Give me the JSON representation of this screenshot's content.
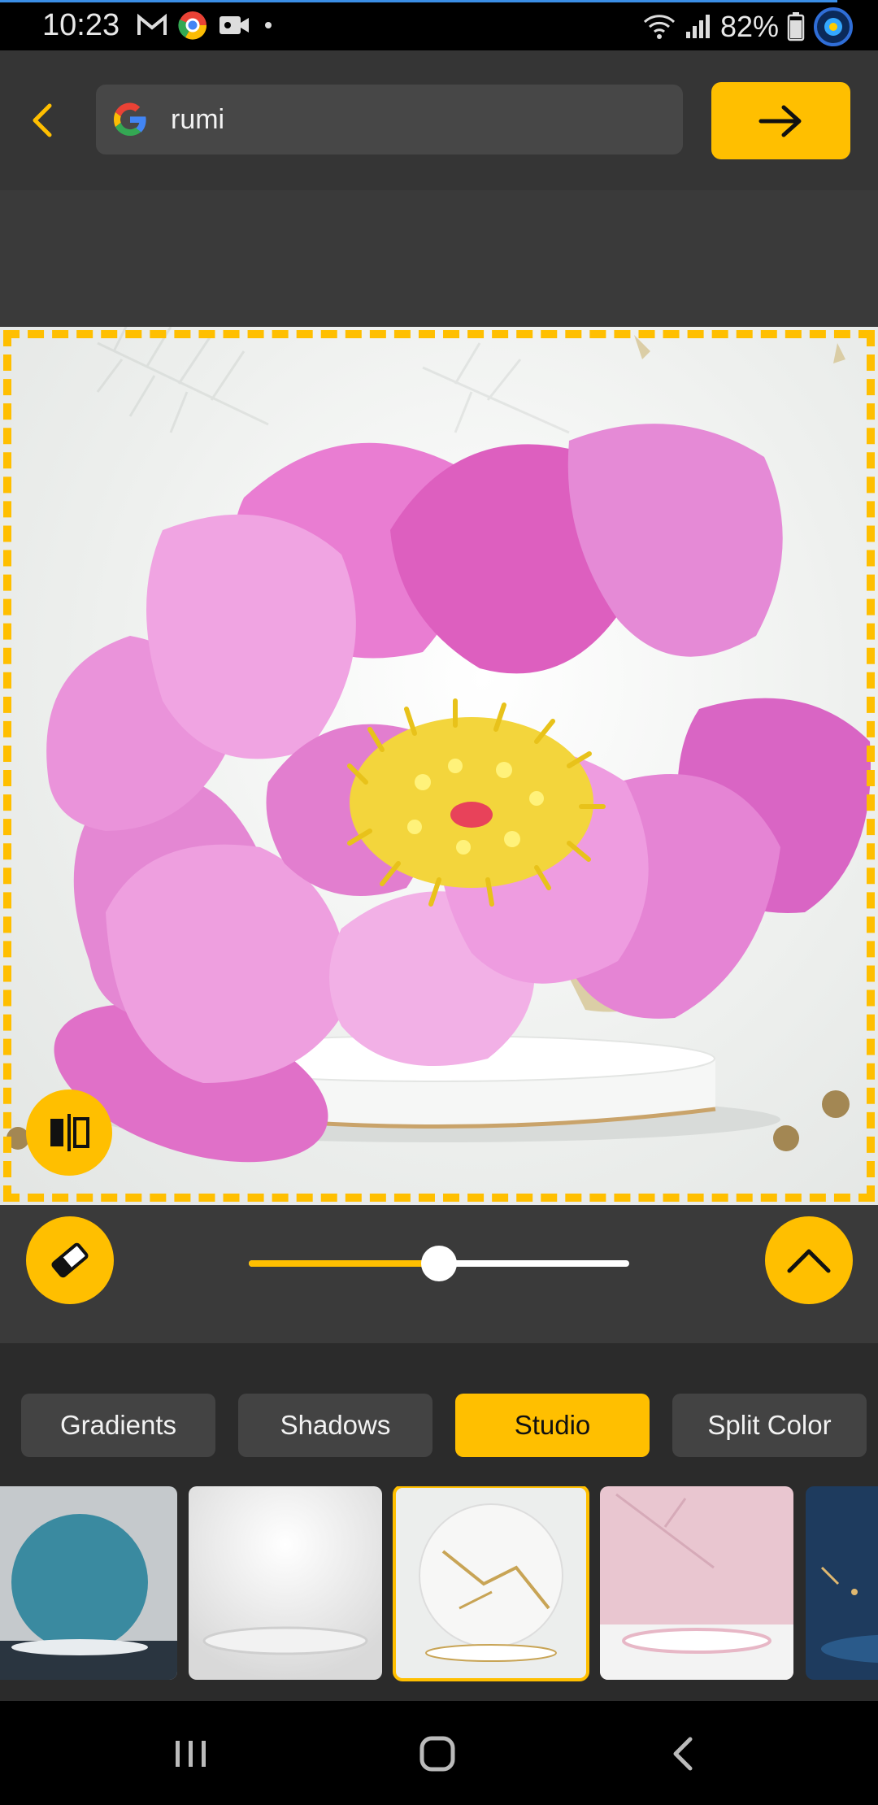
{
  "status_bar": {
    "time": "10:23",
    "battery": "82%",
    "icons": [
      "gmail-icon",
      "chrome-icon",
      "video-icon",
      "dot-icon",
      "wifi-icon",
      "signal-icon",
      "battery-icon",
      "app-overlay-icon"
    ]
  },
  "search": {
    "value": "rumi",
    "engine_icon": "google-logo-icon"
  },
  "colors": {
    "accent": "#ffbf00",
    "panel": "#3a3a3a",
    "background": "#2b2b2b"
  },
  "editor": {
    "intensity_slider_value": 0.5
  },
  "tabs": [
    {
      "label": "Gradients",
      "active": false
    },
    {
      "label": "Shadows",
      "active": false
    },
    {
      "label": "Studio",
      "active": true
    },
    {
      "label": "Split Color",
      "active": false
    }
  ],
  "backgrounds": [
    {
      "name": "teal-circle-stage",
      "selected": false
    },
    {
      "name": "white-studio-stage",
      "selected": false
    },
    {
      "name": "marble-gold-stage",
      "selected": true
    },
    {
      "name": "pink-leaf-stage",
      "selected": false
    },
    {
      "name": "blue-night-stage",
      "selected": false
    }
  ]
}
